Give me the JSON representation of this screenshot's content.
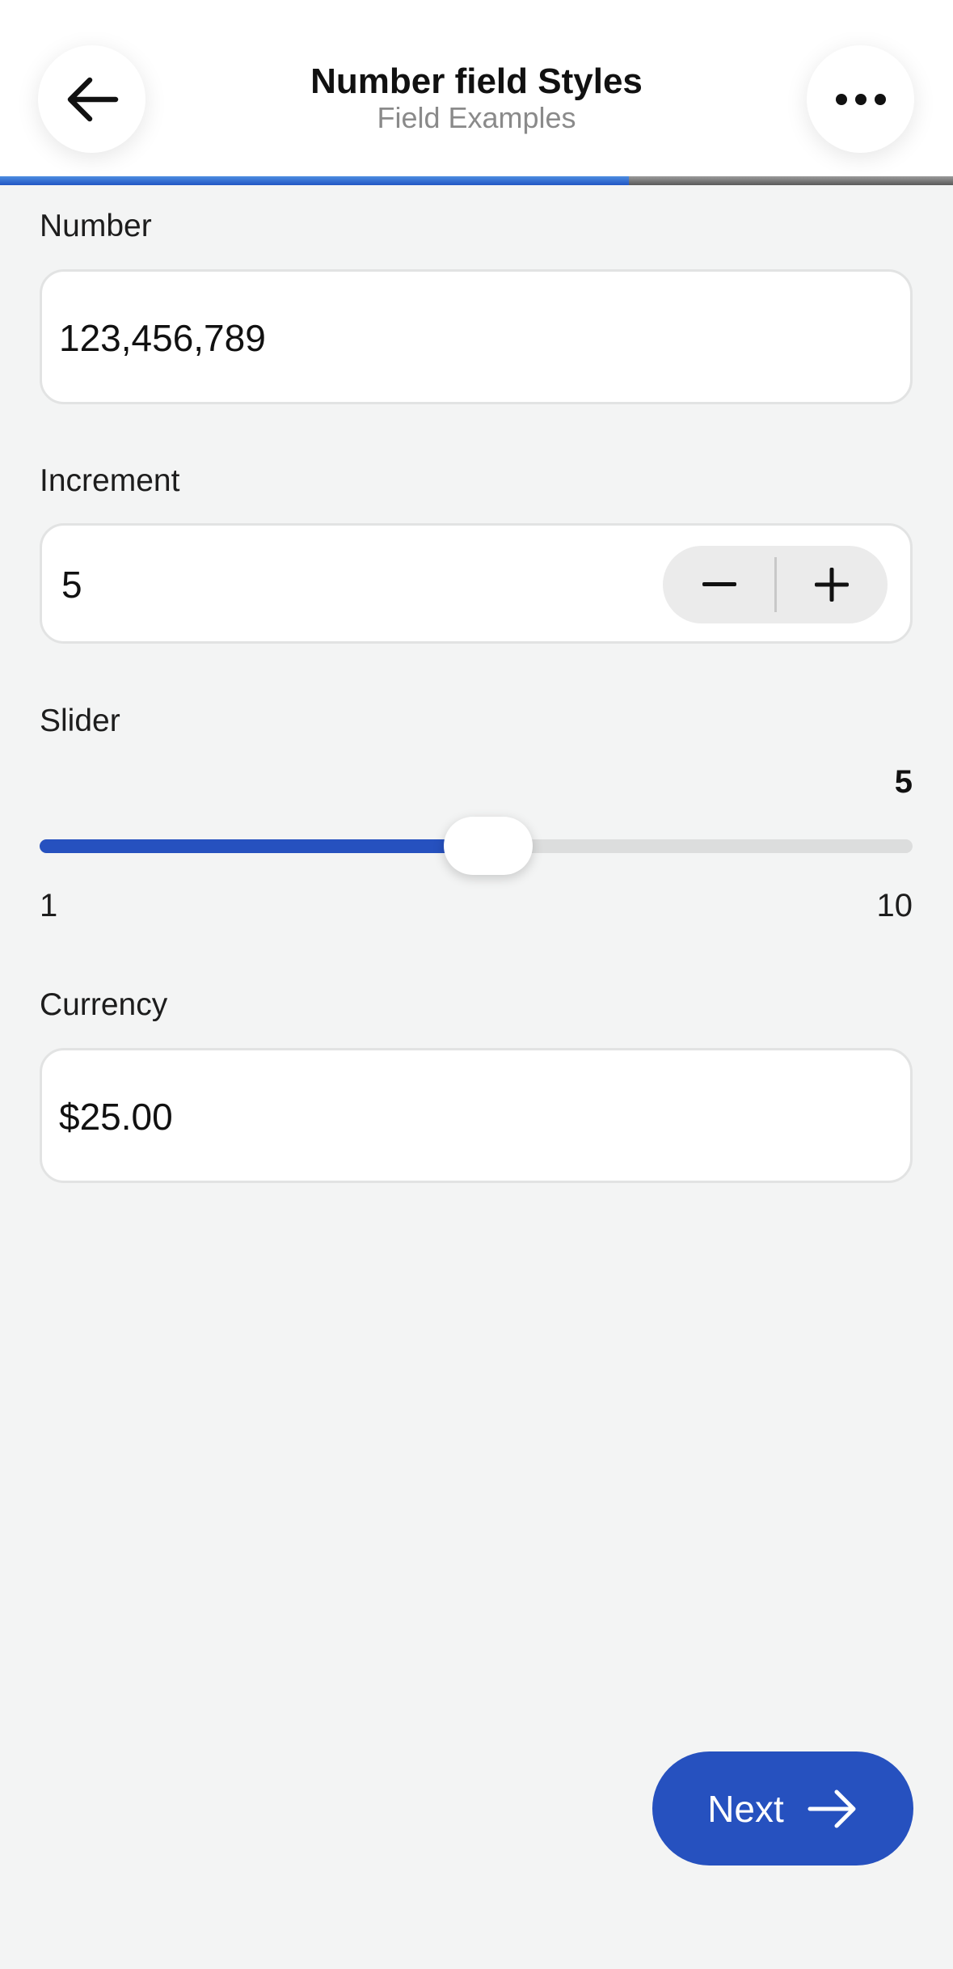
{
  "header": {
    "title": "Number field Styles",
    "subtitle": "Field Examples",
    "back_icon": "arrow-left-icon",
    "more_icon": "more-horizontal-icon"
  },
  "progress": {
    "fraction": 0.66,
    "fill_color": "#2156c4"
  },
  "fields": {
    "number": {
      "label": "Number",
      "value": "123,456,789"
    },
    "increment": {
      "label": "Increment",
      "value": "5",
      "decrement_icon": "minus-icon",
      "increment_icon": "plus-icon"
    },
    "slider": {
      "label": "Slider",
      "value": 5,
      "value_text": "5",
      "min": 1,
      "max": 10,
      "min_label": "1",
      "max_label": "10",
      "fill_color": "#2651bf"
    },
    "currency": {
      "label": "Currency",
      "value": "$25.00"
    }
  },
  "footer": {
    "next_label": "Next",
    "next_icon": "arrow-right-icon",
    "button_color": "#2651bf"
  }
}
